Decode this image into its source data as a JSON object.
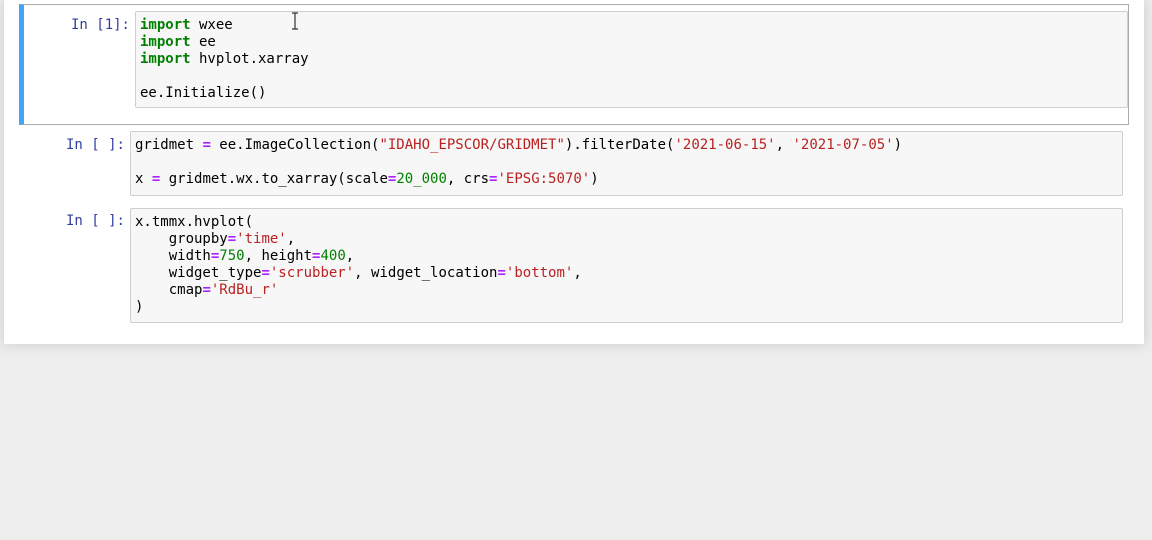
{
  "cells": [
    {
      "prompt": "In [1]:",
      "lines": [
        [
          {
            "t": "import",
            "c": "kw"
          },
          {
            "t": " wxee",
            "c": ""
          }
        ],
        [
          {
            "t": "import",
            "c": "kw"
          },
          {
            "t": " ee",
            "c": ""
          }
        ],
        [
          {
            "t": "import",
            "c": "kw"
          },
          {
            "t": " hvplot.xarray",
            "c": ""
          }
        ],
        [],
        [
          {
            "t": "ee.Initialize()",
            "c": ""
          }
        ]
      ]
    },
    {
      "prompt": "In [ ]:",
      "lines": [
        [
          {
            "t": "gridmet ",
            "c": ""
          },
          {
            "t": "=",
            "c": "op"
          },
          {
            "t": " ee.ImageCollection(",
            "c": ""
          },
          {
            "t": "\"IDAHO_EPSCOR/GRIDMET\"",
            "c": "str"
          },
          {
            "t": ").filterDate(",
            "c": ""
          },
          {
            "t": "'2021-06-15'",
            "c": "str"
          },
          {
            "t": ", ",
            "c": ""
          },
          {
            "t": "'2021-07-05'",
            "c": "str"
          },
          {
            "t": ")",
            "c": ""
          }
        ],
        [],
        [
          {
            "t": "x ",
            "c": ""
          },
          {
            "t": "=",
            "c": "op"
          },
          {
            "t": " gridmet.wx.to_xarray(scale",
            "c": ""
          },
          {
            "t": "=",
            "c": "op"
          },
          {
            "t": "20_000",
            "c": "num"
          },
          {
            "t": ", crs",
            "c": ""
          },
          {
            "t": "=",
            "c": "op"
          },
          {
            "t": "'EPSG:5070'",
            "c": "str"
          },
          {
            "t": ")",
            "c": ""
          }
        ]
      ]
    },
    {
      "prompt": "In [ ]:",
      "lines": [
        [
          {
            "t": "x.tmmx.hvplot(",
            "c": ""
          }
        ],
        [
          {
            "t": "    groupby",
            "c": ""
          },
          {
            "t": "=",
            "c": "op"
          },
          {
            "t": "'time'",
            "c": "str"
          },
          {
            "t": ",",
            "c": ""
          }
        ],
        [
          {
            "t": "    width",
            "c": ""
          },
          {
            "t": "=",
            "c": "op"
          },
          {
            "t": "750",
            "c": "num"
          },
          {
            "t": ", height",
            "c": ""
          },
          {
            "t": "=",
            "c": "op"
          },
          {
            "t": "400",
            "c": "num"
          },
          {
            "t": ",",
            "c": ""
          }
        ],
        [
          {
            "t": "    widget_type",
            "c": ""
          },
          {
            "t": "=",
            "c": "op"
          },
          {
            "t": "'scrubber'",
            "c": "str"
          },
          {
            "t": ", widget_location",
            "c": ""
          },
          {
            "t": "=",
            "c": "op"
          },
          {
            "t": "'bottom'",
            "c": "str"
          },
          {
            "t": ",",
            "c": ""
          }
        ],
        [
          {
            "t": "    cmap",
            "c": ""
          },
          {
            "t": "=",
            "c": "op"
          },
          {
            "t": "'RdBu_r'",
            "c": "str"
          }
        ],
        [
          {
            "t": ")",
            "c": ""
          }
        ]
      ]
    }
  ],
  "cursor_icon": "text-ibeam-cursor-icon"
}
